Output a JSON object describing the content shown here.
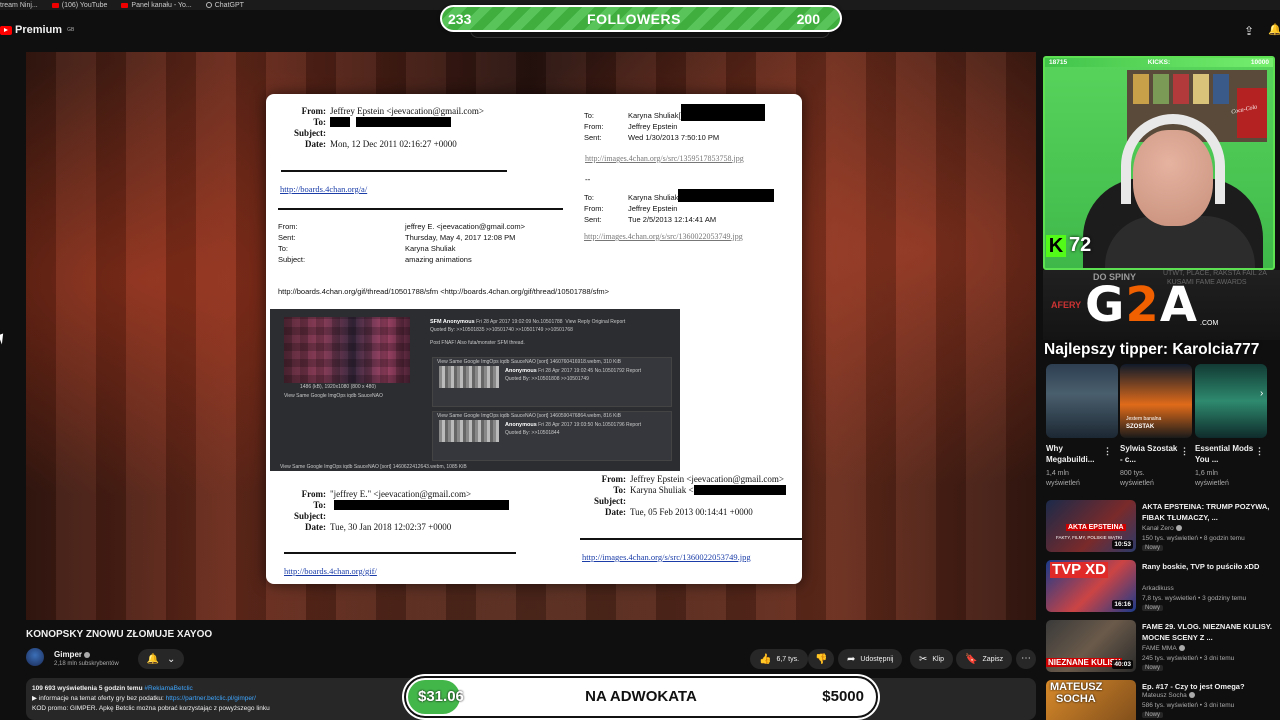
{
  "bookmarks": [
    "tream Ninj...",
    "(106) YouTube",
    "Panel kanału - Yo...",
    "ChatGPT"
  ],
  "header": {
    "logo_text": "Premium",
    "logo_sup": "GB"
  },
  "followers_overlay": {
    "current": "233",
    "label": "FOLLOWERS",
    "goal": "200"
  },
  "document": {
    "e1": {
      "from_label": "From:",
      "from": "Jeffrey Epstein <jeevacation@gmail.com>",
      "to_label": "To:",
      "subject_label": "Subject:",
      "date_label": "Date:",
      "date": "Mon, 12 Dec 2011 02:16:27 +0000",
      "link": "http://boards.4chan.org/a/"
    },
    "e2": {
      "from_label": "From:",
      "from": "jeffrey E. <jeevacation@gmail.com>",
      "sent_label": "Sent:",
      "sent": "Thursday, May 4, 2017 12:08 PM",
      "to_label": "To:",
      "to": "Karyna Shuliak",
      "subject_label": "Subject:",
      "subject": "amazing animations",
      "link_line": "http://boards.4chan.org/gif/thread/10501788/sfm <http://boards.4chan.org/gif/thread/10501788/sfm>"
    },
    "e3": {
      "to_label": "To:",
      "to": "Karyna Shuliak[",
      "from_label": "From:",
      "from": "Jeffrey Epstein",
      "sent_label": "Sent:",
      "sent": "Wed 1/30/2013 7:50:10 PM",
      "link": "http://images.4chan.org/s/src/1359517853758.jpg",
      "sep": "--"
    },
    "e4": {
      "to_label": "To:",
      "to": "Karyna Shuliak",
      "from_label": "From:",
      "from": "Jeffrey Epstein",
      "sent_label": "Sent:",
      "sent": "Tue 2/5/2013 12:14:41 AM",
      "link": "http://images.4chan.org/s/src/1360022053749.jpg"
    },
    "e5": {
      "from_label": "From:",
      "from": "\"jeffrey E.\" <jeevacation@gmail.com>",
      "to_label": "To:",
      "subject_label": "Subject:",
      "date_label": "Date:",
      "date": "Tue, 30 Jan 2018 12:02:37 +0000",
      "link": "http://boards.4chan.org/gif/"
    },
    "e6": {
      "from_label": "From:",
      "from": "Jeffrey Epstein <jeevacation@gmail.com>",
      "to_label": "To:",
      "to": "Karyna Shuliak <",
      "subject_label": "Subject:",
      "date_label": "Date:",
      "date": "Tue, 05 Feb 2013 00:14:41 +0000",
      "link": "http://images.4chan.org/s/src/1360022053749.jpg"
    },
    "forum": {
      "op_name": "SFM Anonymous",
      "op_date": "Fri 28 Apr 2017 19:02:09 No.10501788",
      "op_links": "View   Reply   Original   Report",
      "op_quote": "Quoted By: >>10501835 >>10501740 >>10501749 >>10501768",
      "op_text": "Post FNAF! Also futa/monster SFM thread.",
      "op_file": "1486 (kB), 1920x1080 (800 x 480)",
      "op_search": "View Same   Google   ImgOps   iqdb   SauceNAO",
      "r1_meta": "View Same   Google   ImgOps   iqdb   SauceNAO   [sort]   1460760416918.webm, 310 KiB",
      "r1_name": "Anonymous",
      "r1_date": "Fri 28 Apr 2017 19:02:45 No.10501792",
      "r1_report": "Report",
      "r1_quote": "Quoted By: >>10501808 >>10501749",
      "r2_meta": "View Same   Google   ImgOps   iqdb   SauceNAO   [sort]   1460590476864.webm, 816 KiB",
      "r2_name": "Anonymous",
      "r2_date": "Fri 28 Apr 2017 19:03:50 No.10501796",
      "r2_report": "Report",
      "r2_quote": "Quoted By: >>10501844",
      "footer": "View Same   Google   ImgOps   iqdb   SauceNAO   [sort]   1460622412643.webm, 1085 KiB"
    }
  },
  "video_info": {
    "title": "KONOPSKY ZNOWU ZŁOMUJE XAYOO",
    "channel": "Gimper",
    "subs": "2,18 mln subskrybentów"
  },
  "actions": {
    "likes": "6,7 tys.",
    "share": "Udostępnij",
    "clip": "Klip",
    "save": "Zapisz"
  },
  "description": {
    "stats": "109 693 wyświetlenia  5 godzin temu",
    "tag": "#ReklamaBetclic",
    "line2_prefix": "▶ informacje na temat oferty gry bez podatku:",
    "line2_link": "https://partner.betclic.pl/gimper/",
    "line3": "KOD promo: GIMPER. Apkę Betclic można pobrać korzystając z powyższego linku"
  },
  "donation": {
    "current": "$31.06",
    "title": "NA ADWOKATA",
    "goal": "$5000",
    "progress": 0.0062
  },
  "stream": {
    "kicks_left": "18715",
    "kicks_label": "KICKS:",
    "kicks_right": "10000",
    "kick_count": "72",
    "kick_letter": "K",
    "can": "Coca-Cola",
    "g2a_pre": "G",
    "g2a_two": "2",
    "g2a_post": "A",
    "g2a_com": ".COM",
    "tipper": "Najlepszy tipper: Karolcia777",
    "bg_text1": "DO SPINY",
    "bg_text2": "AFERY",
    "bg_text3": "UTWT, PLACE, RAKSTA FAIL 2A",
    "bg_text4": "KUSAMI FAME AWARDS"
  },
  "shorts": [
    {
      "title": "Why Megabuildi...",
      "views": "1,4 mln",
      "views2": "wyświetleń"
    },
    {
      "title": "Sylwia Szostak - c...",
      "views": "800 tys.",
      "views2": "wyświetleń"
    },
    {
      "title": "Essential Mods You ...",
      "views": "1,6 mln",
      "views2": "wyświetleń"
    }
  ],
  "shorts_thumb_text": {
    "s2": "Jestem banalna",
    "s2b": "SZOSTAK"
  },
  "recommended": [
    {
      "title": "AKTA EPSTEINA: TRUMP POZYWA, FIBAK TŁUMACZY, ...",
      "channel": "Kanał Zero",
      "meta": "150 tys. wyświetleń • 8 godzin temu",
      "badge": "Nowy",
      "duration": "10:53",
      "thumb_text": "AKTA EPSTEINA",
      "thumb_sub": "FAKTY, FILMY, POLSKIE WĄTKI"
    },
    {
      "title": "Rany boskie, TVP to puściło xDD",
      "channel": "Arkadikuss",
      "meta": "7,8 tys. wyświetleń • 3 godziny temu",
      "badge": "Nowy",
      "duration": "16:16",
      "thumb_text": "TVP XD"
    },
    {
      "title": "FAME 29. VLOG. NIEZNANE KULISY. MOCNE SCENY Z ...",
      "channel": "FAME MMA",
      "meta": "245 tys. wyświetleń • 3 dni temu",
      "badge": "Nowy",
      "duration": "40:03",
      "thumb_text": "NIEZNANE KULISY"
    },
    {
      "title": "Ep. #17 - Czy to jest Omega?",
      "channel": "Mateusz Socha",
      "meta": "586 tys. wyświetleń • 3 dni temu",
      "badge": "Nowy",
      "duration": "",
      "thumb_text": "MATEUSZ",
      "thumb_text2": "SOCHA"
    }
  ],
  "colors": {
    "followers_green": "#43b64a",
    "g2a_orange": "#f05f00",
    "kick_green": "#53fc18",
    "link_blue": "#3ea6ff"
  }
}
